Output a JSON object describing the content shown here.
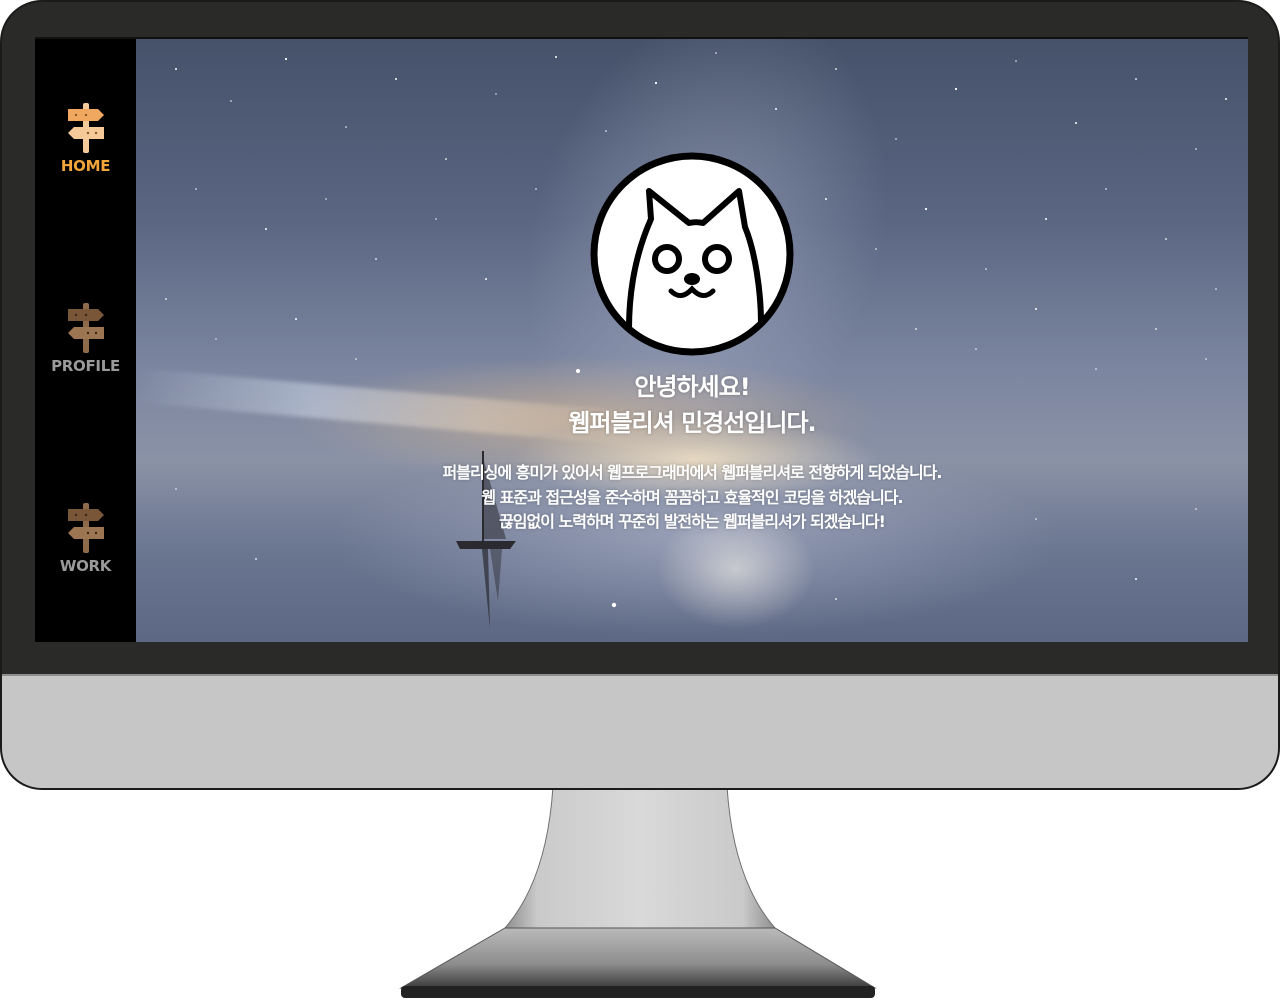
{
  "sidebar": {
    "items": [
      {
        "label": "HOME",
        "icon": "signpost-icon",
        "active": true
      },
      {
        "label": "PROFILE",
        "icon": "signpost-icon",
        "active": false
      },
      {
        "label": "WORK",
        "icon": "signpost-icon",
        "active": false
      }
    ]
  },
  "hero": {
    "avatar": "cat-face-icon",
    "title_line1": "안녕하세요!",
    "title_line2": "웹퍼블리셔 민경선입니다.",
    "desc_line1": "퍼블리싱에 흥미가 있어서 웹프로그래머에서 웹퍼블리셔로 전향하게 되었습니다.",
    "desc_line2": "웹 표준과 접근성을 준수하며 꼼꼼하고 효율적인 코딩을 하겠습니다.",
    "desc_line3": "끊임없이 노력하며 꾸준히 발전하는 웹퍼블리셔가 되겠습니다!"
  },
  "colors": {
    "active_nav": "#f3a53a",
    "inactive_nav": "#9a9a9a",
    "bezel": "#2a2a28",
    "chin": "#c5c6c5"
  }
}
